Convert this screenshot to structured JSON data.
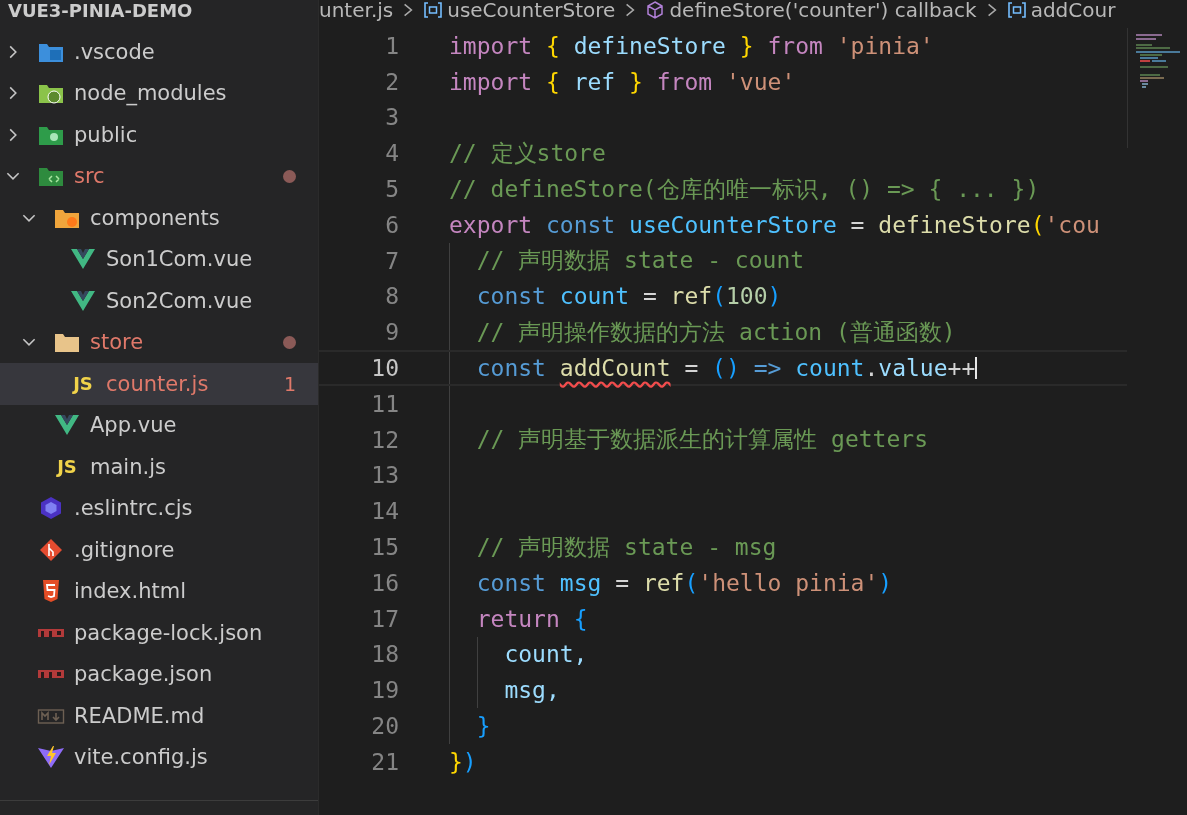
{
  "explorer": {
    "title": "VUE3-PINIA-DEMO",
    "tree": [
      {
        "name": ".vscode",
        "kind": "vscode-folder",
        "expanded": false,
        "selected": false
      },
      {
        "name": "node_modules",
        "kind": "node-folder",
        "expanded": false,
        "selected": false
      },
      {
        "name": "public",
        "kind": "public-folder",
        "expanded": false,
        "selected": false
      },
      {
        "name": "src",
        "kind": "src-folder",
        "expanded": true,
        "modified": true,
        "selected": false,
        "children": [
          {
            "name": "components",
            "kind": "components-folder",
            "expanded": true,
            "selected": false,
            "children": [
              {
                "name": "Son1Com.vue",
                "kind": "vue",
                "selected": false
              },
              {
                "name": "Son2Com.vue",
                "kind": "vue",
                "selected": false
              }
            ]
          },
          {
            "name": "store",
            "kind": "folder",
            "expanded": true,
            "modified": true,
            "selected": false,
            "children": [
              {
                "name": "counter.js",
                "badge": "JS",
                "problems": "1",
                "selected": true
              }
            ]
          },
          {
            "name": "App.vue",
            "kind": "vue",
            "selected": false
          },
          {
            "name": "main.js",
            "badge": "JS",
            "selected": false
          }
        ]
      },
      {
        "name": ".eslintrc.cjs",
        "kind": "eslint",
        "selected": false
      },
      {
        "name": ".gitignore",
        "kind": "git",
        "selected": false
      },
      {
        "name": "index.html",
        "kind": "html",
        "selected": false
      },
      {
        "name": "package-lock.json",
        "kind": "npm",
        "selected": false
      },
      {
        "name": "package.json",
        "kind": "npm",
        "selected": false
      },
      {
        "name": "README.md",
        "kind": "markdown",
        "selected": false
      },
      {
        "name": "vite.config.js",
        "kind": "vite",
        "selected": false
      }
    ]
  },
  "breadcrumb": [
    {
      "label": "unter.js",
      "kind": "file"
    },
    {
      "label": "useCounterStore",
      "kind": "variable"
    },
    {
      "label": "defineStore('counter') callback",
      "kind": "method"
    },
    {
      "label": "addCour",
      "kind": "variable"
    }
  ],
  "editor": {
    "lines": [
      {
        "number": "1",
        "tokens": [
          {
            "text": "import ",
            "kind": "kw"
          },
          {
            "text": "{",
            "kind": "b1"
          },
          {
            "text": " defineStore ",
            "kind": "var"
          },
          {
            "text": "}",
            "kind": "b1"
          },
          {
            "text": " from ",
            "kind": "kw"
          },
          {
            "text": "'pinia'",
            "kind": "str"
          }
        ]
      },
      {
        "number": "2",
        "tokens": [
          {
            "text": "import ",
            "kind": "kw"
          },
          {
            "text": "{",
            "kind": "b1"
          },
          {
            "text": " ref ",
            "kind": "var"
          },
          {
            "text": "}",
            "kind": "b1"
          },
          {
            "text": " from ",
            "kind": "kw"
          },
          {
            "text": "'vue'",
            "kind": "str"
          }
        ]
      },
      {
        "number": "3"
      },
      {
        "number": "4",
        "tokens": [
          {
            "text": "// 定义store",
            "kind": "cmt"
          }
        ]
      },
      {
        "number": "5",
        "tokens": [
          {
            "text": "// defineStore(仓库的唯一标识, () => { ... })",
            "kind": "cmt"
          }
        ]
      },
      {
        "number": "6",
        "tokens": [
          {
            "text": "export ",
            "kind": "kw"
          },
          {
            "text": "const ",
            "kind": "storage"
          },
          {
            "text": "useCounterStore",
            "kind": "const"
          },
          {
            "text": " = ",
            "kind": "op"
          },
          {
            "text": "defineStore",
            "kind": "fn"
          },
          {
            "text": "(",
            "kind": "b1"
          },
          {
            "text": "'cou",
            "kind": "str"
          }
        ]
      },
      {
        "number": "7",
        "tokens": [
          {
            "text": "  // 声明数据 state - count",
            "kind": "cmt"
          }
        ]
      },
      {
        "number": "8",
        "tokens": [
          {
            "text": "  const ",
            "kind": "storage"
          },
          {
            "text": "count",
            "kind": "const"
          },
          {
            "text": " = ",
            "kind": "op"
          },
          {
            "text": "ref",
            "kind": "fn"
          },
          {
            "text": "(",
            "kind": "b3"
          },
          {
            "text": "100",
            "kind": "num"
          },
          {
            "text": ")",
            "kind": "b3"
          }
        ]
      },
      {
        "number": "9",
        "tokens": [
          {
            "text": "  // 声明操作数据的方法 action (普通函数)",
            "kind": "cmt"
          }
        ]
      },
      {
        "number": "10",
        "current": true,
        "cursor": true,
        "tokens": [
          {
            "text": "  const ",
            "kind": "storage"
          },
          {
            "text": "addCount",
            "kind": "fn",
            "error": true
          },
          {
            "text": " = ",
            "kind": "op"
          },
          {
            "text": "()",
            "kind": "b3"
          },
          {
            "text": " => ",
            "kind": "storage"
          },
          {
            "text": "count",
            "kind": "const"
          },
          {
            "text": ".",
            "kind": "op"
          },
          {
            "text": "value",
            "kind": "var"
          },
          {
            "text": "++",
            "kind": "op"
          }
        ]
      },
      {
        "number": "11"
      },
      {
        "number": "12",
        "tokens": [
          {
            "text": "  // 声明基于数据派生的计算属性 getters",
            "kind": "cmt"
          }
        ]
      },
      {
        "number": "13"
      },
      {
        "number": "14"
      },
      {
        "number": "15",
        "tokens": [
          {
            "text": "  // 声明数据 state - msg",
            "kind": "cmt"
          }
        ]
      },
      {
        "number": "16",
        "tokens": [
          {
            "text": "  const ",
            "kind": "storage"
          },
          {
            "text": "msg",
            "kind": "const"
          },
          {
            "text": " = ",
            "kind": "op"
          },
          {
            "text": "ref",
            "kind": "fn"
          },
          {
            "text": "(",
            "kind": "b3"
          },
          {
            "text": "'hello pinia'",
            "kind": "str"
          },
          {
            "text": ")",
            "kind": "b3"
          }
        ]
      },
      {
        "number": "17",
        "tokens": [
          {
            "text": "  return ",
            "kind": "kw"
          },
          {
            "text": "{",
            "kind": "b3"
          }
        ]
      },
      {
        "number": "18",
        "tokens": [
          {
            "text": "    count,",
            "kind": "var"
          }
        ]
      },
      {
        "number": "19",
        "tokens": [
          {
            "text": "    msg,",
            "kind": "var"
          }
        ]
      },
      {
        "number": "20",
        "tokens": [
          {
            "text": "  }",
            "kind": "b3"
          }
        ]
      },
      {
        "number": "21",
        "tokens": [
          {
            "text": "}",
            "kind": "b1"
          },
          {
            "text": ")",
            "kind": "b3"
          }
        ]
      }
    ]
  }
}
